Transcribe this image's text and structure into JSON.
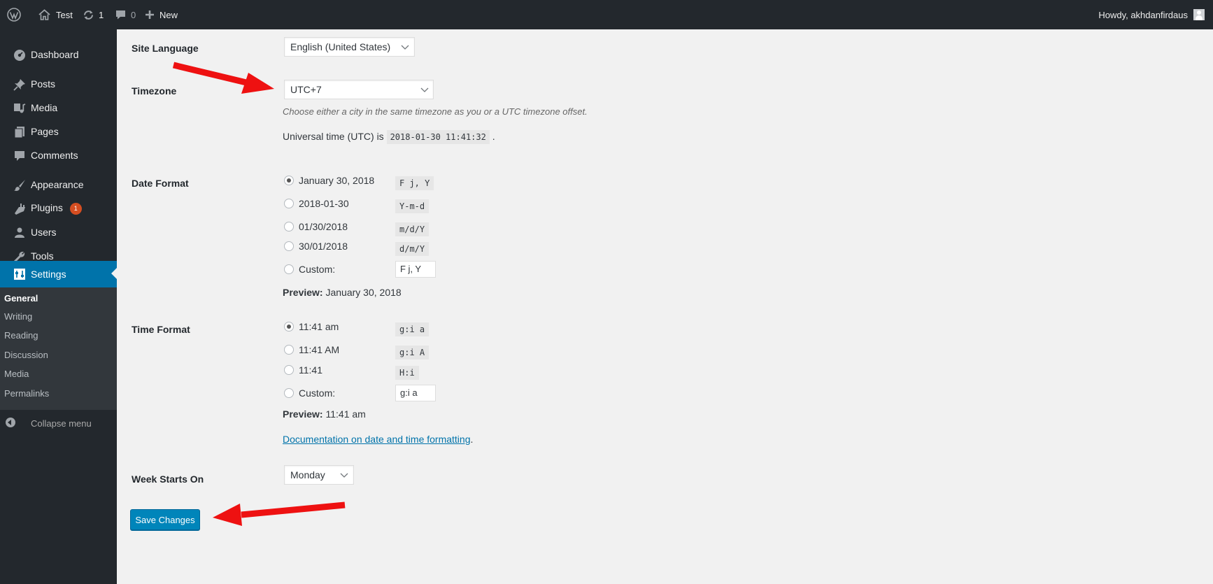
{
  "adminbar": {
    "site_name": "Test",
    "updates_count": "1",
    "comments_count": "0",
    "new_label": "New",
    "howdy": "Howdy, akhdanfirdaus"
  },
  "menu": {
    "items": [
      {
        "label": "Dashboard",
        "icon": "dashboard-icon"
      },
      {
        "label": "Posts",
        "icon": "pin-icon"
      },
      {
        "label": "Media",
        "icon": "media-icon"
      },
      {
        "label": "Pages",
        "icon": "pages-icon"
      },
      {
        "label": "Comments",
        "icon": "comment-icon"
      },
      {
        "label": "Appearance",
        "icon": "brush-icon"
      },
      {
        "label": "Plugins",
        "icon": "plug-icon"
      },
      {
        "label": "Users",
        "icon": "users-icon"
      },
      {
        "label": "Tools",
        "icon": "wrench-icon"
      },
      {
        "label": "Settings",
        "icon": "settings-icon"
      }
    ],
    "plugins_badge": "1",
    "submenu": [
      "General",
      "Writing",
      "Reading",
      "Discussion",
      "Media",
      "Permalinks"
    ],
    "collapse_label": "Collapse menu"
  },
  "settings": {
    "site_language": {
      "label": "Site Language",
      "value": "English (United States)"
    },
    "timezone": {
      "label": "Timezone",
      "value": "UTC+7",
      "description": "Choose either a city in the same timezone as you or a UTC timezone offset.",
      "utc_prefix": "Universal time (UTC) is",
      "utc_value": "2018-01-30 11:41:32",
      "utc_suffix": "."
    },
    "date_format": {
      "label": "Date Format",
      "options": [
        {
          "label": "January 30, 2018",
          "code": "F j, Y",
          "checked": true
        },
        {
          "label": "2018-01-30",
          "code": "Y-m-d",
          "checked": false
        },
        {
          "label": "01/30/2018",
          "code": "m/d/Y",
          "checked": false
        },
        {
          "label": "30/01/2018",
          "code": "d/m/Y",
          "checked": false
        }
      ],
      "custom_label": "Custom:",
      "custom_value": "F j, Y",
      "preview_label": "Preview:",
      "preview_value": "January 30, 2018"
    },
    "time_format": {
      "label": "Time Format",
      "options": [
        {
          "label": "11:41 am",
          "code": "g:i a",
          "checked": true
        },
        {
          "label": "11:41 AM",
          "code": "g:i A",
          "checked": false
        },
        {
          "label": "11:41",
          "code": "H:i",
          "checked": false
        }
      ],
      "custom_label": "Custom:",
      "custom_value": "g:i a",
      "preview_label": "Preview:",
      "preview_value": "11:41 am"
    },
    "doc_link": "Documentation on date and time formatting",
    "doc_link_suffix": ".",
    "week_starts_on": {
      "label": "Week Starts On",
      "value": "Monday"
    },
    "save_label": "Save Changes"
  },
  "colors": {
    "menu_bg": "#23282d",
    "submenu_bg": "#32373c",
    "accent": "#0073aa",
    "button": "#0085ba",
    "badge": "#d54e21",
    "annotation_arrow": "#ff0000"
  }
}
